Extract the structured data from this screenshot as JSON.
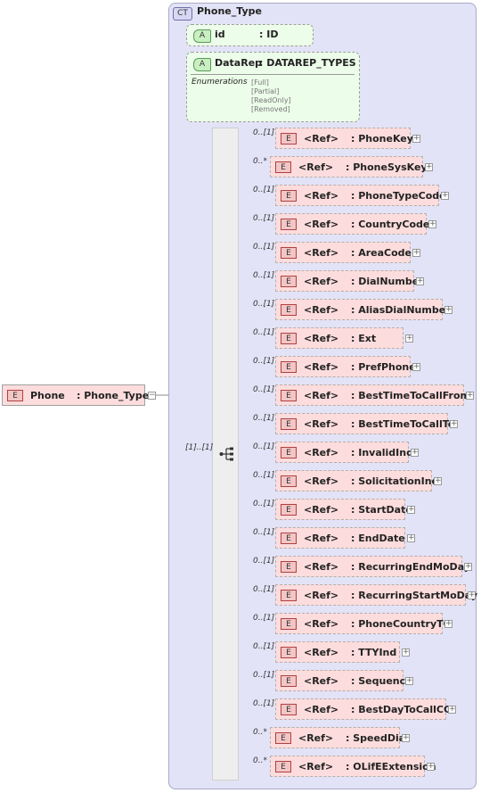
{
  "root": {
    "badge": "E",
    "name": "Phone",
    "type": ": Phone_Type"
  },
  "complex_type": {
    "badge": "CT",
    "name": "Phone_Type"
  },
  "attributes": [
    {
      "badge": "A",
      "name": "id",
      "type": ": ID"
    },
    {
      "badge": "A",
      "name": "DataRep",
      "type": ": DATAREP_TYPES",
      "enumerations_label": "Enumerations",
      "enumerations": [
        "[Full]",
        "[Partial]",
        "[ReadOnly]",
        "[Removed]"
      ]
    }
  ],
  "sequence": {
    "cardinality": "[1]..[1]"
  },
  "elements": [
    {
      "badge": "E",
      "ref": "<Ref>",
      "name": ": PhoneKey",
      "card": "0..[1]"
    },
    {
      "badge": "E",
      "ref": "<Ref>",
      "name": ": PhoneSysKey",
      "card": "0..*"
    },
    {
      "badge": "E",
      "ref": "<Ref>",
      "name": ": PhoneTypeCode",
      "card": "0..[1]"
    },
    {
      "badge": "E",
      "ref": "<Ref>",
      "name": ": CountryCode",
      "card": "0..[1]"
    },
    {
      "badge": "E",
      "ref": "<Ref>",
      "name": ": AreaCode",
      "card": "0..[1]"
    },
    {
      "badge": "E",
      "ref": "<Ref>",
      "name": ": DialNumber",
      "card": "0..[1]"
    },
    {
      "badge": "E",
      "ref": "<Ref>",
      "name": ": AliasDialNumber",
      "card": "0..[1]"
    },
    {
      "badge": "E",
      "ref": "<Ref>",
      "name": ": Ext",
      "card": "0..[1]"
    },
    {
      "badge": "E",
      "ref": "<Ref>",
      "name": ": PrefPhone",
      "card": "0..[1]"
    },
    {
      "badge": "E",
      "ref": "<Ref>",
      "name": ": BestTimeToCallFrom",
      "card": "0..[1]"
    },
    {
      "badge": "E",
      "ref": "<Ref>",
      "name": ": BestTimeToCallTo",
      "card": "0..[1]"
    },
    {
      "badge": "E",
      "ref": "<Ref>",
      "name": ": InvalidInd",
      "card": "0..[1]"
    },
    {
      "badge": "E",
      "ref": "<Ref>",
      "name": ": SolicitationInd",
      "card": "0..[1]"
    },
    {
      "badge": "E",
      "ref": "<Ref>",
      "name": ": StartDate",
      "card": "0..[1]"
    },
    {
      "badge": "E",
      "ref": "<Ref>",
      "name": ": EndDate",
      "card": "0..[1]"
    },
    {
      "badge": "E",
      "ref": "<Ref>",
      "name": ": RecurringEndMoDay",
      "card": "0..[1]"
    },
    {
      "badge": "E",
      "ref": "<Ref>",
      "name": ": RecurringStartMoDay",
      "card": "0..[1]"
    },
    {
      "badge": "E",
      "ref": "<Ref>",
      "name": ": PhoneCountryTC",
      "card": "0..[1]"
    },
    {
      "badge": "E",
      "ref": "<Ref>",
      "name": ": TTYInd",
      "card": "0..[1]"
    },
    {
      "badge": "E",
      "ref": "<Ref>",
      "name": ": Sequence",
      "card": "0..[1]"
    },
    {
      "badge": "E",
      "ref": "<Ref>",
      "name": ": BestDayToCallCC",
      "card": "0..[1]"
    },
    {
      "badge": "E",
      "ref": "<Ref>",
      "name": ": SpeedDial",
      "card": "0..*"
    },
    {
      "badge": "E",
      "ref": "<Ref>",
      "name": ": OLifEExtension",
      "card": "0..*"
    }
  ],
  "colors": {
    "complex_type_bg": "#e3e3f7",
    "attribute_bg": "#ecfde9",
    "element_bg": "#fcdcdc"
  }
}
